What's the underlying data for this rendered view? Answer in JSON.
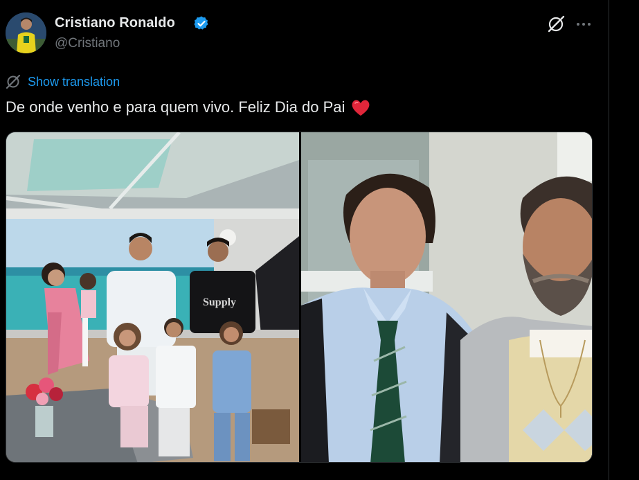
{
  "author": {
    "name": "Cristiano Ronaldo",
    "handle": "@Cristiano",
    "verified_color": "#1d9bf0"
  },
  "actions": {
    "grok_icon": "grok-icon",
    "more_icon": "more-icon"
  },
  "translation": {
    "label": "Show translation",
    "icon": "translate-icon",
    "color": "#1d9bf0"
  },
  "tweet": {
    "text": "De onde venho e para quem vivo. Feliz Dia do Pai",
    "emoji": "red-heart-emoji"
  },
  "media": {
    "count": 2,
    "items": [
      {
        "kind": "photo",
        "subject": "family-on-yacht-photo"
      },
      {
        "kind": "photo",
        "subject": "father-and-son-photo"
      }
    ]
  },
  "colors": {
    "background": "#000000",
    "text": "#e7e9ea",
    "secondary": "#71767b",
    "accent": "#1d9bf0",
    "heart": "#f91880"
  }
}
